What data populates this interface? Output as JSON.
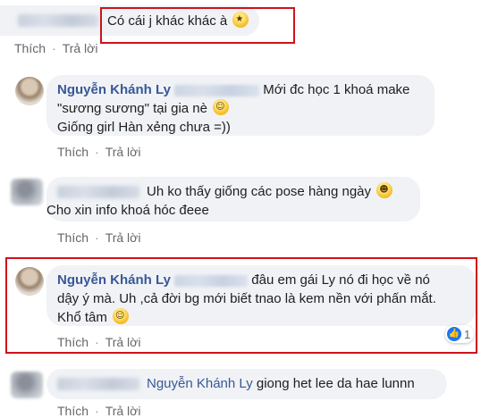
{
  "comments": [
    {
      "author": "",
      "text": "Có cái j khác khác à",
      "emoji": "star-struck",
      "actions": {
        "like": "Thích",
        "reply": "Trả lời"
      }
    },
    {
      "author": "Nguyễn Khánh Ly",
      "text_line1": "Mới đc học 1 khoá make",
      "text_line2": "\"sương sương\" tại gia nè",
      "text_line3": "Giống girl Hàn xẻng chưa =))",
      "emoji": "grinning-sweat",
      "actions": {
        "like": "Thích",
        "reply": "Trả lời"
      }
    },
    {
      "author": "",
      "text_line1": "Uh ko thấy giống các pose hàng ngày",
      "text_line2": "Cho xin info khoá hóc đeee",
      "emoji": "grinning",
      "actions": {
        "like": "Thích",
        "reply": "Trả lời"
      }
    },
    {
      "author": "Nguyễn Khánh Ly",
      "text_line1": "đâu em gái Ly nó đi học về nó",
      "text_line2": "dậy ý mà. Uh ,cả đời bg mới biết tnao là kem nền với phấn mắt.",
      "text_line3": "Khổ tâm",
      "emoji": "laughing-tears",
      "reaction_count": "1",
      "actions": {
        "like": "Thích",
        "reply": "Trả lời"
      }
    },
    {
      "mention": "Nguyễn Khánh Ly",
      "text": "giong het lee da hae lunnn",
      "actions": {
        "like": "Thích",
        "reply": "Trả lời"
      }
    }
  ],
  "colors": {
    "highlight": "#d0111b",
    "name": "#385898",
    "bubble": "#f0f2f5",
    "meta": "#65676b"
  }
}
